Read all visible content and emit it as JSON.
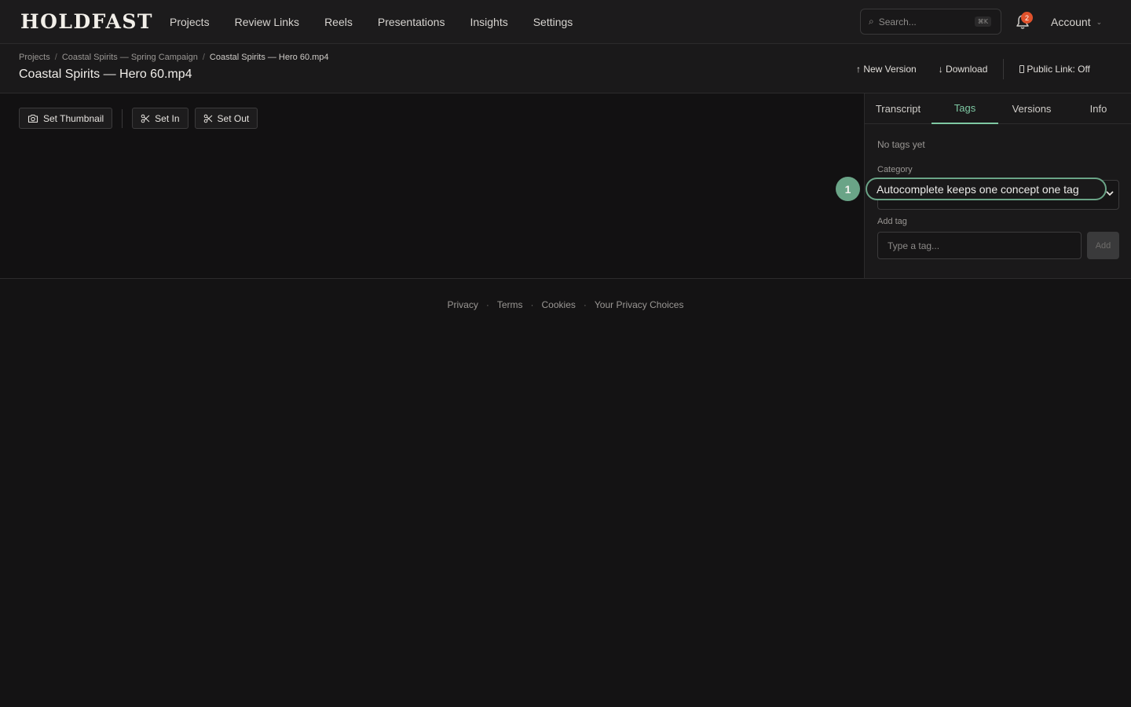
{
  "brand": {
    "logo_text": "HOLDFAST"
  },
  "nav": {
    "items": [
      {
        "label": "Projects"
      },
      {
        "label": "Review Links"
      },
      {
        "label": "Reels"
      },
      {
        "label": "Presentations"
      },
      {
        "label": "Insights"
      },
      {
        "label": "Settings"
      }
    ],
    "search_placeholder": "Search...",
    "search_shortcut": "⌘K",
    "notification_count": "2",
    "account_label": "Account"
  },
  "breadcrumb": {
    "items": [
      "Projects",
      "Coastal Spirits — Spring Campaign",
      "Coastal Spirits — Hero 60.mp4"
    ],
    "separator": "/"
  },
  "page": {
    "title": "Coastal Spirits — Hero 60.mp4"
  },
  "header_actions": {
    "new_version": "↑ New Version",
    "download": "↓ Download",
    "public_link": "Public Link: Off"
  },
  "toolbar": {
    "set_thumbnail": "Set Thumbnail",
    "set_in": "Set In",
    "set_out": "Set Out"
  },
  "panel": {
    "tabs": [
      {
        "label": "Transcript"
      },
      {
        "label": "Tags"
      },
      {
        "label": "Versions"
      },
      {
        "label": "Info"
      }
    ],
    "active_tab": "Tags",
    "empty_text": "No tags yet",
    "category_label": "Category",
    "add_tag_label": "Add tag",
    "tag_placeholder": "Type a tag...",
    "add_button": "Add"
  },
  "callout": {
    "number": "1",
    "text": "Autocomplete keeps one concept one tag"
  },
  "footer": {
    "links": [
      "Privacy",
      "Terms",
      "Cookies",
      "Your Privacy Choices"
    ],
    "separator": "·"
  },
  "colors": {
    "accent": "#7ec8a3",
    "callout": "#6aa487",
    "badge": "#e0522c",
    "background": "#141314"
  }
}
